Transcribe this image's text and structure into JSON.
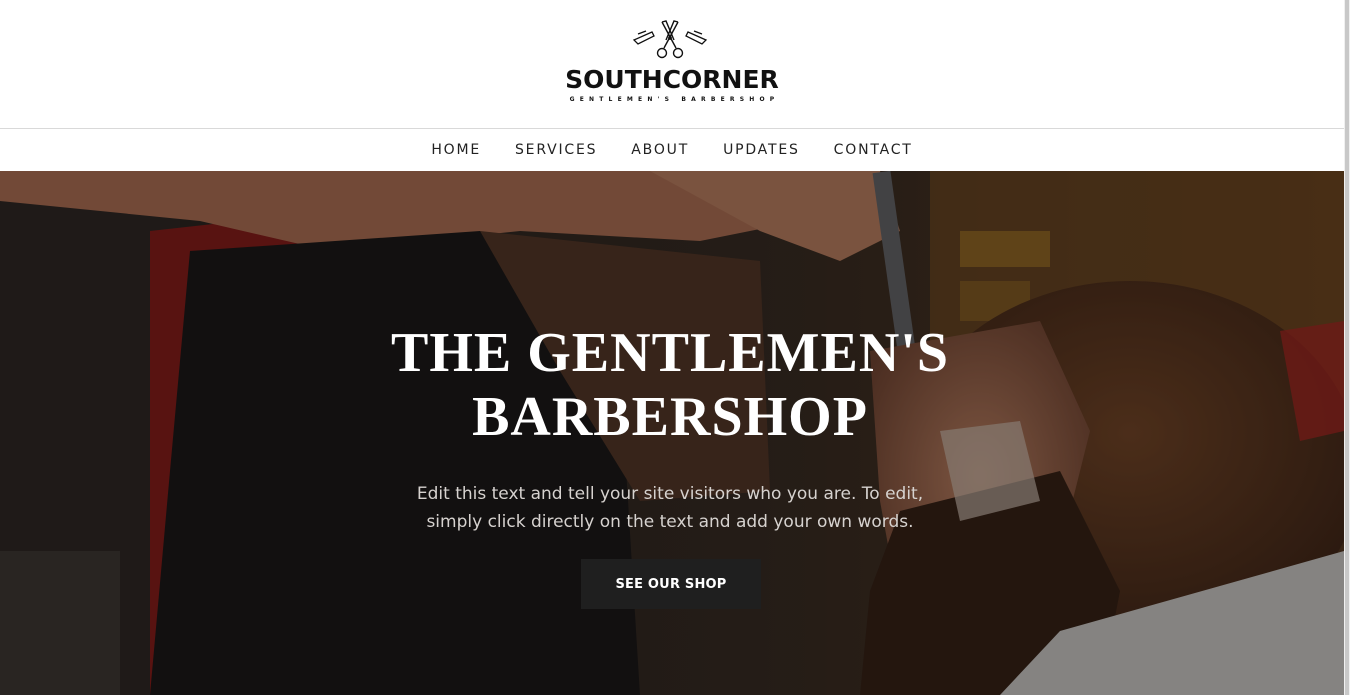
{
  "brand": {
    "name": "SOUTHCORNER",
    "tagline": "GENTLEMEN'S BARBERSHOP",
    "icon": "crossed-scissors-razors-icon"
  },
  "nav": {
    "items": [
      "HOME",
      "SERVICES",
      "ABOUT",
      "UPDATES",
      "CONTACT"
    ]
  },
  "hero": {
    "title_line1": "THE GENTLEMEN'S",
    "title_line2": "BARBERSHOP",
    "text_line1": "Edit this text and tell your site visitors who you are. To edit,",
    "text_line2": "simply click directly on the text and add your own words.",
    "button_label": "SEE OUR SHOP",
    "image": "barber-shaving-customer-photo"
  },
  "colors": {
    "header_bg": "#ffffff",
    "text_dark": "#111111",
    "hero_title": "#ffffff",
    "hero_text": "#d6d2cf",
    "button_bg": "#1f1f1f"
  }
}
